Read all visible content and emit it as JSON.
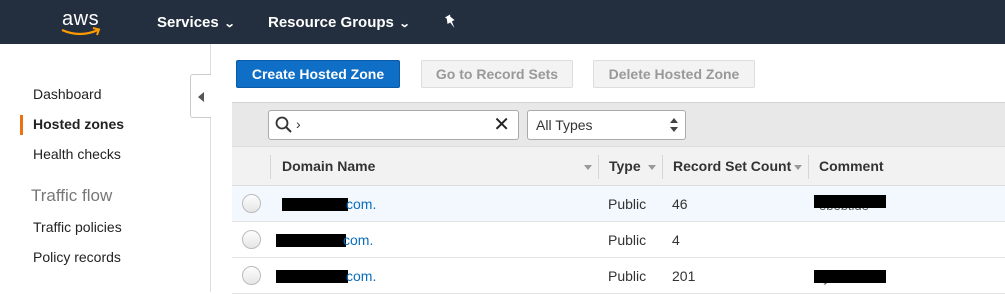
{
  "topnav": {
    "logo_text": "aws",
    "services_label": "Services",
    "resource_groups_label": "Resource Groups"
  },
  "sidebar": {
    "items": [
      {
        "label": "Dashboard"
      },
      {
        "label": "Hosted zones",
        "active": true
      },
      {
        "label": "Health checks"
      }
    ],
    "section_title": "Traffic flow",
    "section_items": [
      {
        "label": "Traffic policies"
      },
      {
        "label": "Policy records"
      }
    ]
  },
  "toolbar": {
    "create_label": "Create Hosted Zone",
    "goto_label": "Go to Record Sets",
    "delete_label": "Delete Hosted Zone"
  },
  "filter": {
    "search_value": "",
    "type_selected": "All Types"
  },
  "table": {
    "columns": [
      "Domain Name",
      "Type",
      "Record Set Count",
      "Comment"
    ],
    "rows": [
      {
        "domain_suffix": "com.",
        "type": "Public",
        "record_count": "46",
        "comment_partial": "ebebtide"
      },
      {
        "domain_suffix": "com.",
        "type": "Public",
        "record_count": "4",
        "comment_partial": ""
      },
      {
        "domain_suffix": "com.",
        "type": "Public",
        "record_count": "201",
        "comment_partial": "ryenbeba"
      }
    ]
  },
  "colors": {
    "nav_bg": "#232f3e",
    "primary_button": "#0f6fc6",
    "active_accent": "#ec7211",
    "link": "#0a6ebd"
  }
}
